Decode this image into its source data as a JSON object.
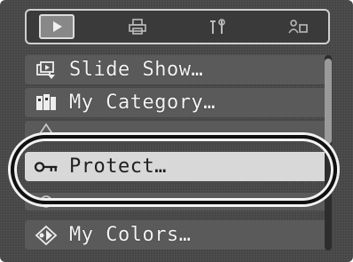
{
  "tabs": [
    {
      "name": "play-tab",
      "icon": "play-icon",
      "active": true
    },
    {
      "name": "print-tab",
      "icon": "printer-icon",
      "active": false
    },
    {
      "name": "tools-tab",
      "icon": "tools-icon",
      "active": false
    },
    {
      "name": "settings-tab",
      "icon": "my-menu-icon",
      "active": false
    }
  ],
  "menu": {
    "items": [
      {
        "label": "Slide Show…",
        "icon": "slide-show-icon"
      },
      {
        "label": "My Category…",
        "icon": "my-category-icon"
      },
      {
        "label": "",
        "icon": "erase-icon"
      },
      {
        "label": "Protect…",
        "icon": "key-icon"
      },
      {
        "label": "",
        "icon": "red-eye-icon"
      },
      {
        "label": "My Colors…",
        "icon": "my-colors-icon"
      }
    ],
    "selected_index": 3
  },
  "colors": {
    "screen": "#454545",
    "item": "#5a5a5a",
    "selected": "#d8d8d8"
  }
}
